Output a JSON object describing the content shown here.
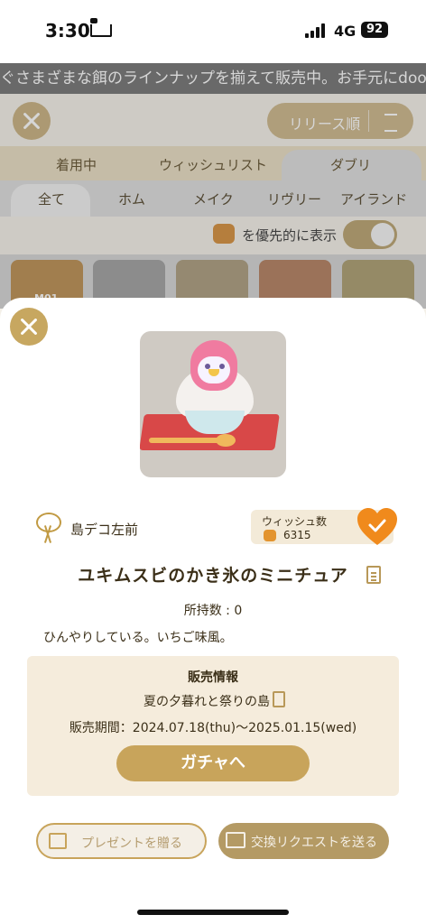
{
  "status_bar": {
    "time": "3:30",
    "network": "4G",
    "battery": "92"
  },
  "background": {
    "ticker_text": "ぐさまざまな餌のラインナップを揃えて販売中。お手元にdoodooをご",
    "sort_label": "リリース順",
    "tabs_primary": [
      "着用中",
      "ウィッシュリスト",
      "ダブリ"
    ],
    "tabs_secondary": [
      "全て",
      "ホム",
      "メイク",
      "リヴリー",
      "アイランド"
    ],
    "priority_label": "を優先的に表示",
    "thumb_first_label": "M01"
  },
  "item": {
    "shop_name": "島デコ左前",
    "wish_label": "ウィッシュ数",
    "wish_count": "6315",
    "title": "ユキムスビのかき氷のミニチュア",
    "owned": "所持数 : 0",
    "description": "ひんやりしている。いちご味風。"
  },
  "sales": {
    "title": "販売情報",
    "island": "夏の夕暮れと祭りの島",
    "period": "販売期間：2024.07.18(thu)〜2025.01.15(wed)",
    "gacha_button": "ガチャへ"
  },
  "actions": {
    "present_button": "プレゼントを贈る",
    "exchange_button": "交換リクエストを送る"
  },
  "colors": {
    "accent": "#c8a45b",
    "heart": "#f08a1c",
    "sales_bg": "#f5ecdc"
  }
}
